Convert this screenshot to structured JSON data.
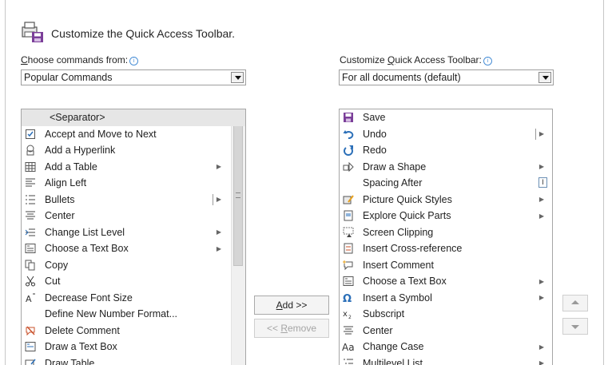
{
  "header": {
    "title": "Customize the Quick Access Toolbar."
  },
  "left": {
    "label_prefix": "",
    "label_accel": "C",
    "label_rest": "hoose commands from:",
    "dropdown_value": "Popular Commands",
    "items": [
      {
        "label": "<Separator>",
        "icon": "none",
        "submenu": false,
        "selected": true
      },
      {
        "label": "Accept and Move to Next",
        "icon": "accept-change-icon",
        "submenu": false
      },
      {
        "label": "Add a Hyperlink",
        "icon": "hyperlink-icon",
        "submenu": false
      },
      {
        "label": "Add a Table",
        "icon": "table-icon",
        "submenu": true
      },
      {
        "label": "Align Left",
        "icon": "align-left-icon",
        "submenu": false
      },
      {
        "label": "Bullets",
        "icon": "bullets-icon",
        "submenu": true,
        "split": true
      },
      {
        "label": "Center",
        "icon": "align-center-icon",
        "submenu": false
      },
      {
        "label": "Change List Level",
        "icon": "list-level-icon",
        "submenu": true
      },
      {
        "label": "Choose a Text Box",
        "icon": "text-box-icon",
        "submenu": true
      },
      {
        "label": "Copy",
        "icon": "copy-icon",
        "submenu": false
      },
      {
        "label": "Cut",
        "icon": "scissors-icon",
        "submenu": false
      },
      {
        "label": "Decrease Font Size",
        "icon": "decrease-font-icon",
        "submenu": false
      },
      {
        "label": "Define New Number Format...",
        "icon": "none",
        "submenu": false
      },
      {
        "label": "Delete Comment",
        "icon": "delete-comment-icon",
        "submenu": false
      },
      {
        "label": "Draw a Text Box",
        "icon": "draw-text-box-icon",
        "submenu": false
      },
      {
        "label": "Draw Table",
        "icon": "draw-table-icon",
        "submenu": false
      }
    ]
  },
  "right": {
    "label_prefix": "Customize ",
    "label_accel": "Q",
    "label_rest": "uick Access Toolbar:",
    "dropdown_value": "For all documents (default)",
    "items": [
      {
        "label": "Save",
        "icon": "save-icon",
        "submenu": false
      },
      {
        "label": "Undo",
        "icon": "undo-icon",
        "submenu": true,
        "split": true
      },
      {
        "label": "Redo",
        "icon": "redo-icon",
        "submenu": false
      },
      {
        "label": "Draw a Shape",
        "icon": "draw-shape-icon",
        "submenu": true
      },
      {
        "label": "Spacing After",
        "icon": "none",
        "submenu": false,
        "control": true
      },
      {
        "label": "Picture Quick Styles",
        "icon": "picture-styles-icon",
        "submenu": true
      },
      {
        "label": "Explore Quick Parts",
        "icon": "quick-parts-icon",
        "submenu": true
      },
      {
        "label": "Screen Clipping",
        "icon": "screen-clipping-icon",
        "submenu": false
      },
      {
        "label": "Insert Cross-reference",
        "icon": "cross-reference-icon",
        "submenu": false
      },
      {
        "label": "Insert Comment",
        "icon": "insert-comment-icon",
        "submenu": false
      },
      {
        "label": "Choose a Text Box",
        "icon": "text-box-icon",
        "submenu": true
      },
      {
        "label": "Insert a Symbol",
        "icon": "omega-icon",
        "submenu": true
      },
      {
        "label": "Subscript",
        "icon": "subscript-icon",
        "submenu": false
      },
      {
        "label": "Center",
        "icon": "align-center-icon",
        "submenu": false
      },
      {
        "label": "Change Case",
        "icon": "change-case-icon",
        "submenu": true
      },
      {
        "label": "Multilevel List",
        "icon": "multilevel-list-icon",
        "submenu": true
      }
    ]
  },
  "buttons": {
    "add_accel": "A",
    "add_rest": "dd >>",
    "remove_prefix": "<< ",
    "remove_accel": "R",
    "remove_rest": "emove"
  }
}
